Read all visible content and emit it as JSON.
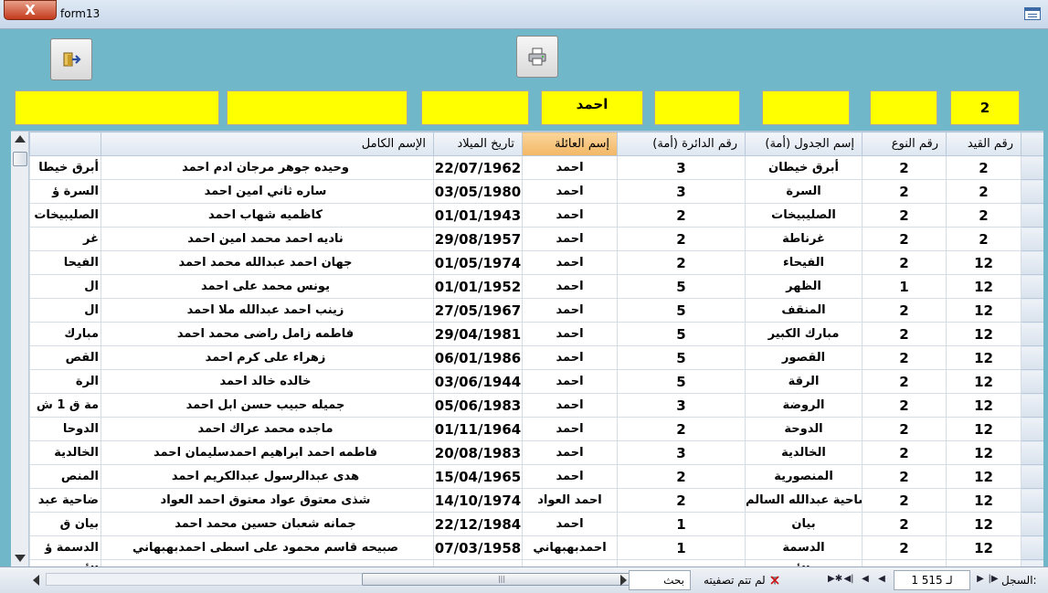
{
  "window": {
    "title": "form13",
    "close_label": "X"
  },
  "toolbar": {
    "exit_icon": "exit-icon",
    "print_icon": "print-icon"
  },
  "filters": [
    "",
    "",
    "",
    "احمد",
    "",
    "",
    "",
    "2"
  ],
  "columns": [
    "",
    "الإسم الكامل",
    "تاريخ الميلاد",
    "إسم العائلة",
    "رقم الدائرة (أمة)",
    "إسم الجدول (أمة)",
    "رقم النوع",
    "رقم القيد"
  ],
  "rows": [
    {
      "extra": "أبرق خيطا",
      "full_name": "وحيده جوهر مرجان ادم احمد",
      "dob": "22/07/1962",
      "family": "احمد",
      "district": "3",
      "table": "أبرق خيطان",
      "type": "2",
      "reg": "2"
    },
    {
      "extra": "السرة ؤ",
      "full_name": "ساره ثاني امين احمد",
      "dob": "03/05/1980",
      "family": "احمد",
      "district": "3",
      "table": "السرة",
      "type": "2",
      "reg": "2"
    },
    {
      "extra": "الصليبيخات",
      "full_name": "كاظميه شهاب احمد",
      "dob": "01/01/1943",
      "family": "احمد",
      "district": "2",
      "table": "الصليبيخات",
      "type": "2",
      "reg": "2"
    },
    {
      "extra": "غر",
      "full_name": "ناديه احمد محمد امين احمد",
      "dob": "29/08/1957",
      "family": "احمد",
      "district": "2",
      "table": "غرناطة",
      "type": "2",
      "reg": "2"
    },
    {
      "extra": "الفيحا",
      "full_name": "جهان احمد عبدالله محمد احمد",
      "dob": "01/05/1974",
      "family": "احمد",
      "district": "2",
      "table": "الفيحاء",
      "type": "2",
      "reg": "12"
    },
    {
      "extra": "ال",
      "full_name": "يونس محمد على احمد",
      "dob": "01/01/1952",
      "family": "احمد",
      "district": "5",
      "table": "الظهر",
      "type": "1",
      "reg": "12"
    },
    {
      "extra": "ال",
      "full_name": "زينب احمد عبدالله ملا احمد",
      "dob": "27/05/1967",
      "family": "احمد",
      "district": "5",
      "table": "المنقف",
      "type": "2",
      "reg": "12"
    },
    {
      "extra": "مبارك",
      "full_name": "فاطمه زامل راضى محمد احمد",
      "dob": "29/04/1981",
      "family": "احمد",
      "district": "5",
      "table": "مبارك الكبير",
      "type": "2",
      "reg": "12"
    },
    {
      "extra": "القص",
      "full_name": "زهراء على كرم احمد",
      "dob": "06/01/1986",
      "family": "احمد",
      "district": "5",
      "table": "القصور",
      "type": "2",
      "reg": "12"
    },
    {
      "extra": "الرة",
      "full_name": "خالده خالد احمد",
      "dob": "03/06/1944",
      "family": "احمد",
      "district": "5",
      "table": "الرقة",
      "type": "2",
      "reg": "12"
    },
    {
      "extra": "مة ق 1 ش",
      "full_name": "جميله حبيب حسن ابل احمد",
      "dob": "05/06/1983",
      "family": "احمد",
      "district": "3",
      "table": "الروضة",
      "type": "2",
      "reg": "12"
    },
    {
      "extra": "الدوحا",
      "full_name": "ماجده محمد عراك احمد",
      "dob": "01/11/1964",
      "family": "احمد",
      "district": "2",
      "table": "الدوحة",
      "type": "2",
      "reg": "12"
    },
    {
      "extra": "الخالدية",
      "full_name": "فاطمه احمد ابراهيم احمدسليمان احمد",
      "dob": "20/08/1983",
      "family": "احمد",
      "district": "3",
      "table": "الخالدية",
      "type": "2",
      "reg": "12"
    },
    {
      "extra": "المنص",
      "full_name": "هدى عبدالرسول عبدالكريم احمد",
      "dob": "15/04/1965",
      "family": "احمد",
      "district": "2",
      "table": "المنصورية",
      "type": "2",
      "reg": "12"
    },
    {
      "extra": "ضاحية عبد",
      "full_name": "شذى معتوق عواد معتوق احمد العواد",
      "dob": "14/10/1974",
      "family": "احمد العواد",
      "district": "2",
      "table": "ضاحية عبدالله السالم",
      "type": "2",
      "reg": "12"
    },
    {
      "extra": "بيان ق",
      "full_name": "جمانه شعبان حسين محمد احمد",
      "dob": "22/12/1984",
      "family": "احمد",
      "district": "1",
      "table": "بيان",
      "type": "2",
      "reg": "12"
    },
    {
      "extra": "الدسمة ؤ",
      "full_name": "صبيحه قاسم محمود على اسطى احمدبهبهاني",
      "dob": "07/03/1958",
      "family": "احمدبهبهاني",
      "district": "1",
      "table": "الدسمة",
      "type": "2",
      "reg": "12"
    },
    {
      "extra": "الأ",
      "full_name": "",
      "dob": "",
      "family": "",
      "district": "",
      "table": "الأ",
      "type": "",
      "reg": ""
    }
  ],
  "statusbar": {
    "record_label": "السجل:",
    "record_value": "1 لـ 515",
    "filter_status": "لم تتم تصفيته",
    "search_label": "بحث",
    "hscroll_grip": "|||"
  }
}
